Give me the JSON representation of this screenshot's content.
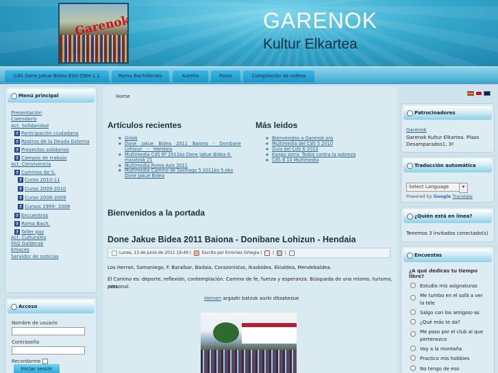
{
  "header": {
    "title": "GARENOK",
    "subtitle": "Kultur Elkartea",
    "logo_sign": "Garenok"
  },
  "nav": [
    "CdS Done Jakue Bidea ESO-DBH 1.1",
    "Roma Bachillerato",
    "Aurelio",
    "Foros",
    "Compilación de videos"
  ],
  "menu": {
    "title": "Menú principal",
    "items": {
      "presentacion": "Presentación",
      "calendario": "Calendario",
      "act_solidaridad": "Act. Solidaridad",
      "participacion": "Participación ciudadana",
      "rostros": "Rostros de la Deuda Externa",
      "proyectos": "Proyectos solidarios",
      "campos": "Campos de trabajo",
      "act_convivencia": "Act. Convivencia",
      "caminos": "Caminos de S.",
      "curso1": "Curso 2010-11",
      "curso2": "Curso 2009-2010",
      "curso3": "Curso 2008-2009",
      "curso4": "Cursos 1999- 2008",
      "encuentros": "Encuentros",
      "roma": "Roma Bach.",
      "taller": "Taller paz",
      "act_culturales": "Act. Culturales",
      "faq": "FAQ Galderak",
      "enlaces": "Enlaces",
      "servidor": "Servidor de noticias"
    }
  },
  "login": {
    "title": "Acceso",
    "user_label": "Nombre de usuario",
    "pass_label": "Contraseña",
    "remember_label": "Recordarme",
    "button": "Iniciar sesión"
  },
  "breadcrumb": "Home",
  "recent": {
    "title": "Artículos recientes",
    "items": [
      "Gidak",
      "Done Jakue Bidea 2011 Baiona - Donibane Lohizun - Hendaia",
      "Multimedia CdS 6º 2011ko Done Jakue Bidea 6. maiatzak 21",
      "Multimedia Roma-Asis 2011",
      "Multimedia Camino de Santiago 5 2011ko 5.eko Done Jakue Bidea"
    ]
  },
  "popular": {
    "title": "Más leidos",
    "items": [
      "Bienvenidos a Garenok.org",
      "Multimedia del CdS 5 2010",
      "Guía del CdS 6 2010",
      "Kanpo zorra. Todos contra la pobreza",
      "CdS 6 10 Multimedia"
    ]
  },
  "welcome": "Bienvenidos a la portada",
  "article": {
    "title": "Done Jakue Bidea 2011 Baiona - Donibane Lohizun - Hendaia",
    "date": "Lunes, 13 de Junio de 2011 16:49",
    "author": "Escrito por Errornes Ortegia",
    "p1": "Los Herran, Samaniego, F. Baraibar, Badaia, Corazonistas, Ikasbidea, Ekialdea, Mendebaldea.",
    "p2a": "El Camino es: deporte, reflexión, contemplación. Camino de fe, fuerza y esperanza. Búsqueda de uno mismo, turismo, reto",
    "p2b": "personal.",
    "link": "Hemen",
    "link_rest": "argazki batzuk aurki ditzakezue"
  },
  "sponsors": {
    "title": "Patrocinadores",
    "link": "Garenok",
    "line1": "Garenok Kultur Elkartea. Plaza",
    "line2": "Desamparados1, 3º"
  },
  "translate": {
    "title": "Traducción automática",
    "select": "Select Language",
    "powered": "Powered by",
    "google": "Google",
    "translate": "Translate"
  },
  "online": {
    "title": "¿Quién está en línea?",
    "text": "Tenemos 3 invitados conectado(s)"
  },
  "poll": {
    "title": "Encuestas",
    "question": "¿A qué dedicas tu tiempo libre?",
    "options": [
      "Estudio mis asignaturas",
      "Me tumbo en el sofá a ver",
      "la tele",
      "Salgo con los amigos/-as",
      "¿Qué más te da?",
      "Me paso por el club al que",
      "pertenezco",
      "Voy a la montaña",
      "Practico mis hobbies",
      "No tengo de eso"
    ]
  }
}
